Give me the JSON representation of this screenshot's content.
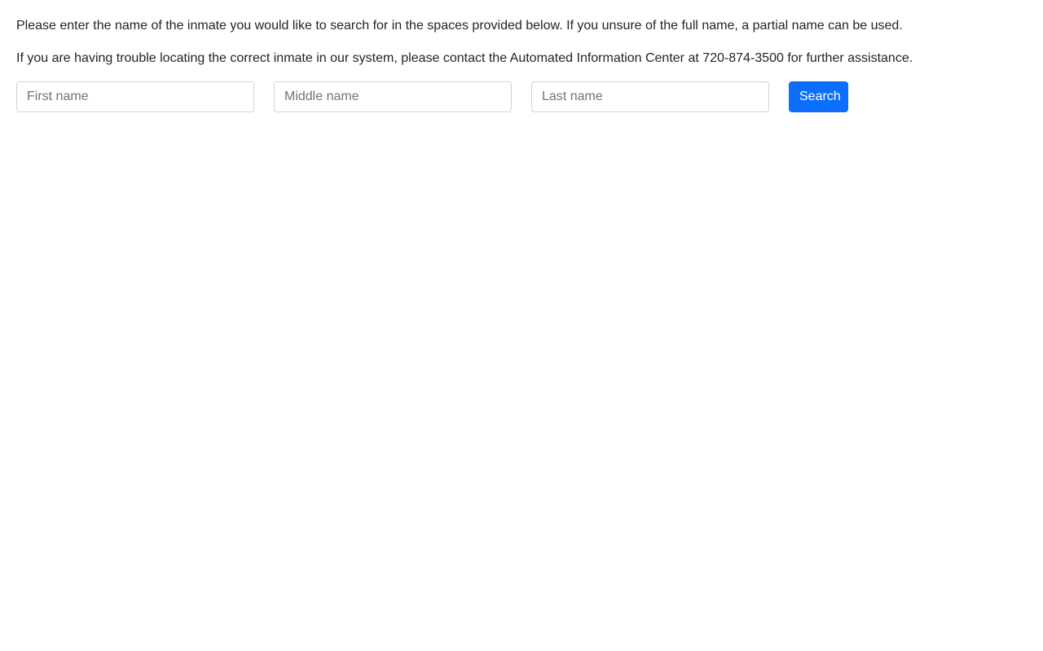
{
  "intro": {
    "paragraph_1": "Please enter the name of the inmate you would like to search for in the spaces provided below. If you unsure of the full name, a partial name can be used.",
    "paragraph_2": "If you are having trouble locating the correct inmate in our system, please contact the Automated Information Center at 720-874-3500 for further assistance."
  },
  "search_form": {
    "first_name": {
      "value": "",
      "placeholder": "First name"
    },
    "middle_name": {
      "value": "",
      "placeholder": "Middle name"
    },
    "last_name": {
      "value": "",
      "placeholder": "Last name"
    },
    "search_label": "Search"
  },
  "colors": {
    "primary": "#0d6efd",
    "text": "#212529",
    "input_border": "#ced4da",
    "placeholder": "#6c757d"
  }
}
